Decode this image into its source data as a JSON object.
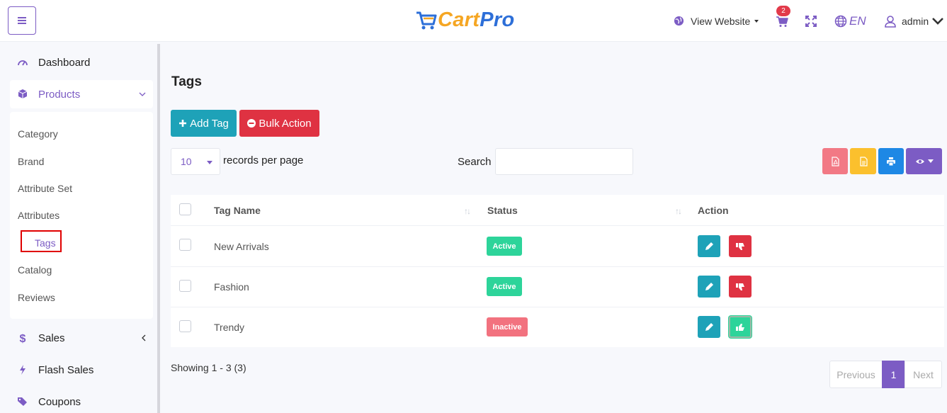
{
  "header": {
    "logo_part1": "Cart",
    "logo_part2": "Pro",
    "view_website": "View Website",
    "cart_count": "2",
    "language": "EN",
    "user": "admin"
  },
  "sidebar": {
    "items": [
      {
        "label": "Dashboard",
        "icon": "gauge-icon"
      },
      {
        "label": "Products",
        "icon": "box-icon"
      },
      {
        "label": "Sales",
        "icon": "dollar-icon"
      },
      {
        "label": "Flash Sales",
        "icon": "bolt-icon"
      },
      {
        "label": "Coupons",
        "icon": "tags-icon"
      }
    ],
    "submenu": [
      "Category",
      "Brand",
      "Attribute Set",
      "Attributes",
      "Tags",
      "Catalog",
      "Reviews"
    ],
    "active_sub": "Tags"
  },
  "main": {
    "title": "Tags",
    "add_button": "Add Tag",
    "bulk_button": "Bulk Action",
    "records_per_page_value": "10",
    "records_per_page_label": "records per page",
    "search_label": "Search",
    "search_value": "",
    "table": {
      "columns": [
        "Tag Name",
        "Status",
        "Action"
      ],
      "rows": [
        {
          "name": "New Arrivals",
          "status": "Active"
        },
        {
          "name": "Fashion",
          "status": "Active"
        },
        {
          "name": "Trendy",
          "status": "Inactive"
        }
      ]
    },
    "showing": "Showing 1 - 3 (3)",
    "pagination": {
      "prev": "Previous",
      "current": "1",
      "next": "Next"
    }
  },
  "colors": {
    "accent": "#7c5cc4",
    "info": "#1ea2b8",
    "danger": "#df3242",
    "success": "#2dd49a",
    "inactive": "#f2727f"
  }
}
